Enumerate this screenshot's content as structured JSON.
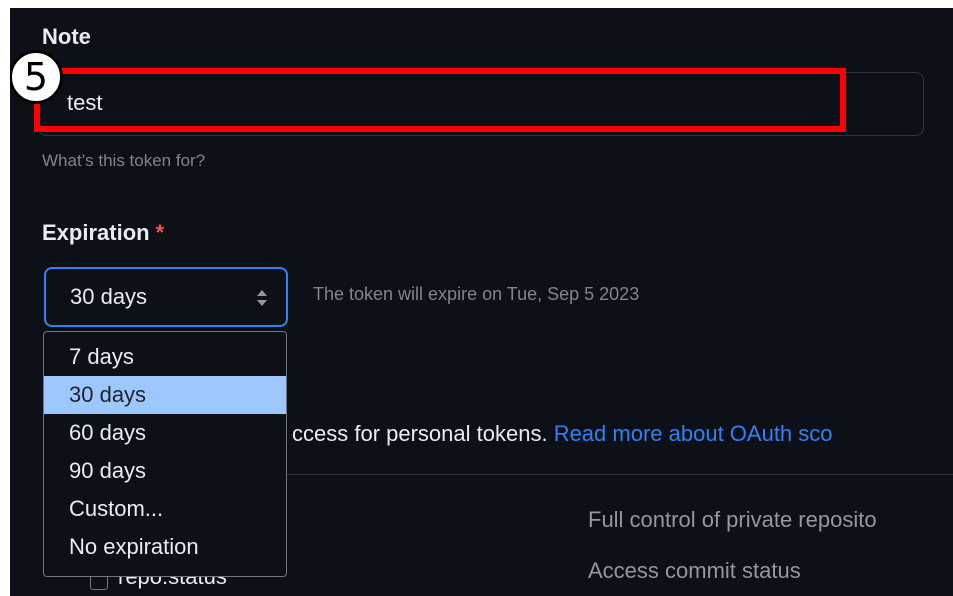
{
  "note": {
    "label": "Note",
    "value": "test",
    "help": "What’s this token for?"
  },
  "annotation": {
    "step_number": "5",
    "highlight_color": "#ff0000"
  },
  "expiration": {
    "label": "Expiration",
    "required_mark": "*",
    "selected": "30 days",
    "expiry_note": "The token will expire on Tue, Sep 5 2023",
    "options": [
      "7 days",
      "30 days",
      "60 days",
      "90 days",
      "Custom...",
      "No expiration"
    ],
    "selected_index": 1
  },
  "scopes": {
    "intro_text": "ccess for personal tokens. ",
    "link_text": "Read more about OAuth sco",
    "rows": [
      {
        "name": "",
        "description": "Full control of private reposito"
      },
      {
        "name": "repo:status",
        "description": "Access commit status"
      }
    ]
  },
  "colors": {
    "background": "#0d1117",
    "text": "#e6edf3",
    "muted": "#7d8590",
    "accent": "#2f81f7",
    "required": "#f85149",
    "option_highlight": "#9ec7ff"
  }
}
